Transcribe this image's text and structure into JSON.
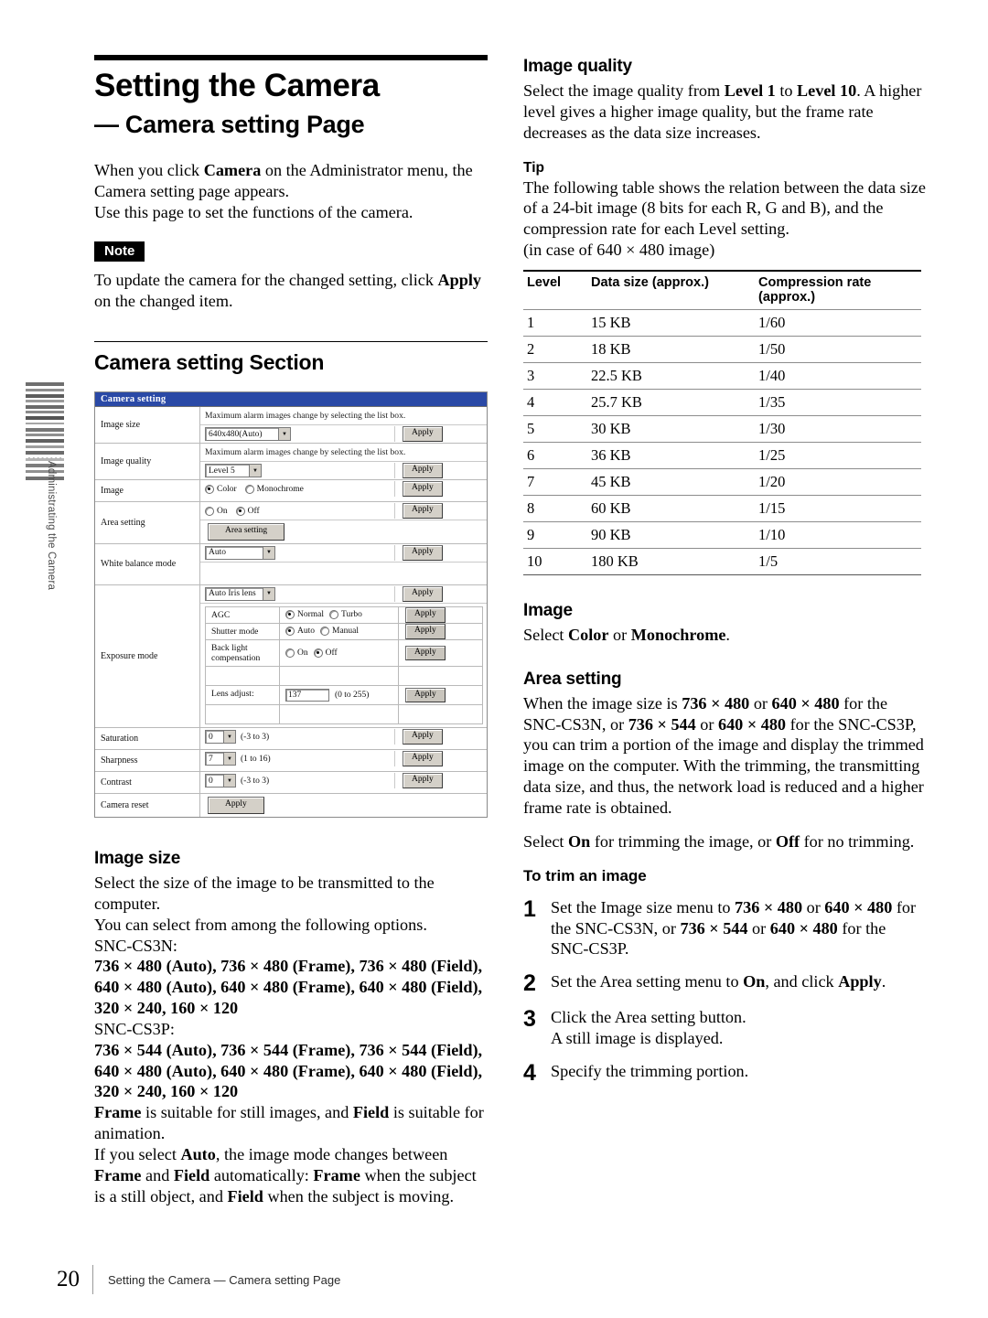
{
  "sidebar": {
    "vertical_label": "Administrating the Camera"
  },
  "left": {
    "title": "Setting the Camera",
    "subtitle": "— Camera setting Page",
    "intro_p1_a": "When you click ",
    "intro_p1_b": "Camera",
    "intro_p1_c": " on the Administrator menu, the Camera setting page appears.",
    "intro_p2": "Use this page to set the functions of the camera.",
    "note_badge": "Note",
    "note_a": "To update the camera for the changed setting, click ",
    "note_b": "Apply",
    "note_c": " on the changed item.",
    "section_heading": "Camera setting Section",
    "image_size": {
      "heading": "Image size",
      "p1": "Select the size of the image to be transmitted to the computer.",
      "p2": "You can select from among the following options.",
      "model_n": "SNC-CS3N:",
      "options_n": "736 × 480 (Auto), 736 × 480 (Frame), 736 × 480 (Field), 640 × 480 (Auto), 640 × 480 (Frame), 640 × 480 (Field), 320 × 240, 160 × 120",
      "model_p": "SNC-CS3P:",
      "options_p": "736 × 544 (Auto), 736 × 544 (Frame), 736 × 544 (Field), 640 × 480 (Auto), 640 × 480 (Frame), 640 × 480 (Field), 320 × 240, 160 × 120",
      "frame_a": "Frame",
      "frame_b": " is suitable for still images, and ",
      "frame_c": "Field",
      "frame_d": " is suitable for animation.",
      "auto_a": "If you select ",
      "auto_b": "Auto",
      "auto_c": ", the image mode changes between ",
      "auto_d": "Frame",
      "auto_e": " and ",
      "auto_f": "Field",
      "auto_g": " automatically: ",
      "auto_h": "Frame",
      "auto_i": " when the subject is a still object, and ",
      "auto_j": "Field",
      "auto_k": " when the subject is moving."
    }
  },
  "screenshot": {
    "window_title": "Camera setting",
    "list_hint": "Maximum alarm images change by selecting the list box.",
    "apply_label": "Apply",
    "rows": {
      "image_size_label": "Image size",
      "image_size_value": "640x480(Auto)",
      "image_quality_label": "Image quality",
      "image_quality_value": "Level 5",
      "image_label": "Image",
      "image_opt1": "Color",
      "image_opt2": "Monochrome",
      "area_label": "Area setting",
      "area_opt1": "On",
      "area_opt2": "Off",
      "area_button": "Area setting",
      "white_balance_label": "White balance mode",
      "white_balance_value": "Auto",
      "exposure_label": "Exposure mode",
      "exposure_value": "Auto Iris lens",
      "agc_label": "AGC",
      "agc_opt1": "Normal",
      "agc_opt2": "Turbo",
      "shutter_label": "Shutter mode",
      "shutter_opt1": "Auto",
      "shutter_opt2": "Manual",
      "backlight_label": "Back light compensation",
      "backlight_opt1": "On",
      "backlight_opt2": "Off",
      "lens_label": "Lens adjust:",
      "lens_value": "137",
      "lens_range": "(0 to 255)",
      "saturation_label": "Saturation",
      "saturation_value": "0",
      "saturation_range": "(-3 to 3)",
      "sharpness_label": "Sharpness",
      "sharpness_value": "7",
      "sharpness_range": "(1 to 16)",
      "contrast_label": "Contrast",
      "contrast_value": "0",
      "contrast_range": "(-3 to 3)",
      "reset_label": "Camera reset"
    }
  },
  "right": {
    "image_quality": {
      "heading": "Image quality",
      "p1_a": "Select the image quality from ",
      "p1_b": "Level 1",
      "p1_c": " to ",
      "p1_d": "Level 10",
      "p1_e": ". A higher level gives a higher image quality, but the frame rate decreases as the data size increases.",
      "tip_heading": "Tip",
      "tip_p": "The following table shows the relation between the data size of a 24-bit image (8 bits for each R, G and B), and the compression rate for each Level setting.",
      "tip_case": "(in case of 640 × 480 image)"
    },
    "table": {
      "headers": [
        "Level",
        "Data size (approx.)",
        "Compression rate (approx.)"
      ],
      "rows": [
        [
          "1",
          "15 KB",
          "1/60"
        ],
        [
          "2",
          "18 KB",
          "1/50"
        ],
        [
          "3",
          "22.5 KB",
          "1/40"
        ],
        [
          "4",
          "25.7 KB",
          "1/35"
        ],
        [
          "5",
          "30 KB",
          "1/30"
        ],
        [
          "6",
          "36 KB",
          "1/25"
        ],
        [
          "7",
          "45 KB",
          "1/20"
        ],
        [
          "8",
          "60 KB",
          "1/15"
        ],
        [
          "9",
          "90 KB",
          "1/10"
        ],
        [
          "10",
          "180 KB",
          "1/5"
        ]
      ]
    },
    "image": {
      "heading": "Image",
      "p_a": "Select ",
      "p_b": "Color",
      "p_c": " or ",
      "p_d": "Monochrome",
      "p_e": "."
    },
    "area_setting": {
      "heading": "Area setting",
      "p1_a": "When the image size is ",
      "p1_b": "736 × 480",
      "p1_c": " or ",
      "p1_d": "640 × 480",
      "p1_e": " for the SNC-CS3N, or  ",
      "p1_f": "736 × 544",
      "p1_g": " or ",
      "p1_h": "640 × 480",
      "p1_i": " for the SNC-CS3P, you can trim a portion of the image and display the trimmed image on the computer.  With the trimming, the transmitting data size, and thus, the network load is reduced and a higher frame rate is obtained.",
      "p2_a": "Select ",
      "p2_b": "On",
      "p2_c": " for trimming the image, or ",
      "p2_d": "Off",
      "p2_e": " for no trimming.",
      "steps_heading": "To trim an image",
      "step1_num": "1",
      "step1_a": "Set the Image size menu to ",
      "step1_b": "736 × 480",
      "step1_c": " or ",
      "step1_d": "640 × 480",
      "step1_e": " for the SNC-CS3N, or  ",
      "step1_f": "736 × 544",
      "step1_g": " or ",
      "step1_h": "640 × 480",
      "step1_i": " for the SNC-CS3P.",
      "step2_num": "2",
      "step2_a": "Set the Area setting menu to ",
      "step2_b": "On",
      "step2_c": ", and click ",
      "step2_d": "Apply",
      "step2_e": ".",
      "step3_num": "3",
      "step3_a": "Click the Area setting button.",
      "step3_b": "A still image is displayed.",
      "step4_num": "4",
      "step4_a": "Specify the trimming portion."
    }
  },
  "footer": {
    "page_number": "20",
    "running_title": "Setting the Camera — Camera setting Page"
  }
}
